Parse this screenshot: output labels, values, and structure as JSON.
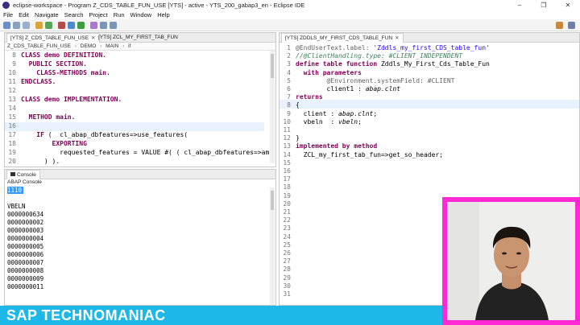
{
  "window": {
    "title": "eclipse-workspace - Program Z_CDS_TABLE_FUN_USE [YTS] - active - YTS_200_gabap3_en - Eclipse IDE",
    "minimize": "–",
    "maximize": "❐",
    "close": "✕"
  },
  "menu": [
    "File",
    "Edit",
    "Navigate",
    "Search",
    "Project",
    "Run",
    "Window",
    "Help"
  ],
  "left_editor": {
    "tabs": [
      {
        "label": "[YTS] Z_CDS_TABLE_FUN_USE",
        "close": "✕"
      },
      {
        "label": "[YTS] ZCL_MY_FIRST_TAB_FUN"
      }
    ],
    "breadcrumb": [
      "Z_CDS_TABLE_FUN_USE",
      "DEMO",
      "MAIN",
      "if"
    ],
    "lines": [
      {
        "num": "8",
        "indent": "",
        "tokens": [
          {
            "t": "CLASS demo DEFINITION.",
            "c": "kw"
          }
        ]
      },
      {
        "num": "9",
        "indent": "  ",
        "tokens": [
          {
            "t": "PUBLIC SECTION.",
            "c": "kw"
          }
        ]
      },
      {
        "num": "10",
        "indent": "    ",
        "tokens": [
          {
            "t": "CLASS-METHODS main.",
            "c": "kw"
          }
        ]
      },
      {
        "num": "11",
        "indent": "",
        "tokens": [
          {
            "t": "ENDCLASS.",
            "c": "kw"
          }
        ]
      },
      {
        "num": "12",
        "indent": "",
        "tokens": []
      },
      {
        "num": "13",
        "indent": "",
        "tokens": [
          {
            "t": "CLASS demo IMPLEMENTATION.",
            "c": "kw"
          }
        ]
      },
      {
        "num": "14",
        "indent": "",
        "tokens": []
      },
      {
        "num": "15",
        "indent": "  ",
        "tokens": [
          {
            "t": "METHOD main.",
            "c": "kw"
          }
        ]
      },
      {
        "num": "16",
        "indent": "",
        "tokens": []
      },
      {
        "num": "17",
        "indent": "    ",
        "tokens": [
          {
            "t": "IF",
            "c": "kw"
          },
          {
            "t": " (  cl_abap_dbfeatures=>use_features(",
            "c": ""
          }
        ]
      },
      {
        "num": "18",
        "indent": "        ",
        "tokens": [
          {
            "t": "EXPORTING",
            "c": "kw"
          }
        ]
      },
      {
        "num": "19",
        "indent": "          ",
        "tokens": [
          {
            "t": "requested_features = VALUE #( ( cl_abap_dbfeatures=>am",
            "c": ""
          }
        ]
      },
      {
        "num": "20",
        "indent": "      ",
        "tokens": [
          {
            "t": ") ).",
            "c": ""
          }
        ]
      }
    ]
  },
  "right_editor": {
    "tab": {
      "label": "[YTS] ZDDLS_MY_FIRST_CDS_TABLE_FUN",
      "close": "✕"
    },
    "lines": [
      {
        "num": "1",
        "indent": "",
        "tokens": [
          {
            "t": "@EndUserText.label: ",
            "c": "an"
          },
          {
            "t": "'Zddls_my_first_CDS_table_fun'",
            "c": "st"
          }
        ]
      },
      {
        "num": "2",
        "indent": "",
        "tokens": [
          {
            "t": "//@ClientHandling.type: #CLIENT_INDEPENDENT",
            "c": "cm"
          }
        ]
      },
      {
        "num": "3",
        "indent": "",
        "tokens": [
          {
            "t": "define table function",
            "c": "kw"
          },
          {
            "t": " Zddls_My_First_Cds_Table_Fun",
            "c": ""
          }
        ]
      },
      {
        "num": "4",
        "indent": "  ",
        "tokens": [
          {
            "t": "with parameters",
            "c": "kw"
          }
        ]
      },
      {
        "num": "5",
        "indent": "        ",
        "tokens": [
          {
            "t": "@Environment.systemField: #CLIENT",
            "c": "an"
          }
        ]
      },
      {
        "num": "6",
        "indent": "        ",
        "tokens": [
          {
            "t": "client1 : ",
            "c": ""
          },
          {
            "t": "abap.clnt",
            "c": "tp"
          }
        ]
      },
      {
        "num": "7",
        "indent": "",
        "tokens": [
          {
            "t": "returns",
            "c": "kw"
          }
        ]
      },
      {
        "num": "8",
        "indent": "",
        "tokens": [
          {
            "t": "{",
            "c": ""
          }
        ]
      },
      {
        "num": "9",
        "indent": "  ",
        "tokens": [
          {
            "t": "client : ",
            "c": ""
          },
          {
            "t": "abap.clnt",
            "c": "tp"
          },
          {
            "t": ";",
            "c": ""
          }
        ]
      },
      {
        "num": "10",
        "indent": "  ",
        "tokens": [
          {
            "t": "vbeln  : ",
            "c": ""
          },
          {
            "t": "vbeln",
            "c": "tp"
          },
          {
            "t": ";",
            "c": ""
          }
        ]
      },
      {
        "num": "11",
        "indent": "",
        "tokens": []
      },
      {
        "num": "12",
        "indent": "",
        "tokens": [
          {
            "t": "}",
            "c": ""
          }
        ]
      },
      {
        "num": "13",
        "indent": "",
        "tokens": [
          {
            "t": "implemented by method",
            "c": "kw"
          }
        ]
      },
      {
        "num": "14",
        "indent": "  ",
        "tokens": [
          {
            "t": "ZCL_my_first_tab_fun=>get_so_header;",
            "c": ""
          }
        ]
      },
      {
        "num": "15",
        "indent": "",
        "tokens": []
      },
      {
        "num": "16",
        "indent": "",
        "tokens": []
      },
      {
        "num": "17",
        "indent": "",
        "tokens": []
      },
      {
        "num": "18",
        "indent": "",
        "tokens": []
      },
      {
        "num": "19",
        "indent": "",
        "tokens": []
      },
      {
        "num": "20",
        "indent": "",
        "tokens": []
      },
      {
        "num": "21",
        "indent": "",
        "tokens": []
      },
      {
        "num": "22",
        "indent": "",
        "tokens": []
      },
      {
        "num": "23",
        "indent": "",
        "tokens": []
      },
      {
        "num": "24",
        "indent": "",
        "tokens": []
      },
      {
        "num": "25",
        "indent": "",
        "tokens": []
      },
      {
        "num": "26",
        "indent": "",
        "tokens": []
      },
      {
        "num": "27",
        "indent": "",
        "tokens": []
      },
      {
        "num": "28",
        "indent": "",
        "tokens": []
      },
      {
        "num": "29",
        "indent": "",
        "tokens": []
      },
      {
        "num": "30",
        "indent": "",
        "tokens": []
      },
      {
        "num": "31",
        "indent": "",
        "tokens": []
      }
    ]
  },
  "console": {
    "tab_label": "Console",
    "view_label": "ABAP Console",
    "selected_line": "1110",
    "header": "VBELN",
    "rows": [
      "0000000634",
      "0000000002",
      "0000000003",
      "0000000004",
      "0000000005",
      "0000000006",
      "0000000007",
      "0000000008",
      "0000000009",
      "0000000011"
    ]
  },
  "banner": {
    "text": "SAP TECHNOMANIAC",
    "color": "#1eb8e8"
  },
  "colors": {
    "keyword": "#7f0055",
    "comment": "#3f7f5f",
    "string": "#2a00ff",
    "highlight_line": "#e8f2fe",
    "selection": "#3399ff",
    "webcam_frame": "#ff2ad4"
  }
}
